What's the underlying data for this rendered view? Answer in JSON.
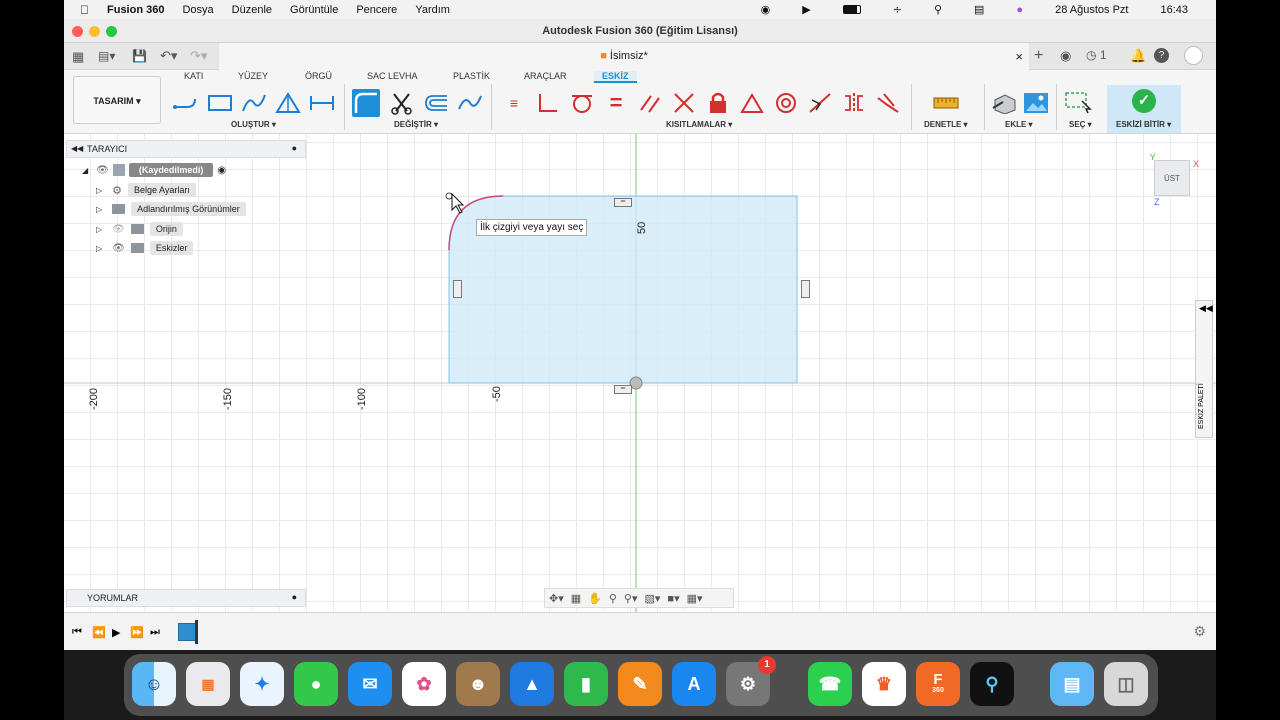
{
  "menubar": {
    "apple": "",
    "app": "Fusion 360",
    "items": [
      "Dosya",
      "Düzenle",
      "Görüntüle",
      "Pencere",
      "Yardım"
    ],
    "date": "28 Ağustos Pzt",
    "time": "16:43"
  },
  "window": {
    "title": "Autodesk Fusion 360 (Eğitim Lisansı)",
    "doc_tab": "İsimsiz*",
    "job_count": "1"
  },
  "ribbon": {
    "mode": "TASARIM ▾",
    "tabs": [
      "KATI",
      "YÜZEY",
      "ÖRGÜ",
      "SAC LEVHA",
      "PLASTİK",
      "ARAÇLAR",
      "ESKİZ"
    ],
    "groups": {
      "create": "OLUŞTUR ▾",
      "modify": "DEĞİŞTİR ▾",
      "constraints": "KISITLAMALAR ▾",
      "inspect": "DENETLE ▾",
      "insert": "EKLE ▾",
      "select": "SEÇ ▾",
      "finish": "ESKİZİ BİTİR ▾"
    }
  },
  "browser": {
    "title": "TARAYICI",
    "root": "(Kaydedilmedi)",
    "items": [
      "Belge Ayarları",
      "Adlandırılmış Görünümler",
      "Orijin",
      "Eskizler"
    ]
  },
  "comments": {
    "title": "YORUMLAR"
  },
  "canvas": {
    "tooltip": "İlk çizgiyi veya yayı seç",
    "dim_label": "50",
    "ruler": [
      "-200",
      "-150",
      "-100",
      "-50"
    ],
    "viewcube": "ÜST",
    "axis_x": "X",
    "axis_y": "Y",
    "axis_z": "Z",
    "palette": "ESKİZ PALETİ"
  },
  "dock": {
    "badge": "1",
    "fusion_label": "360"
  }
}
